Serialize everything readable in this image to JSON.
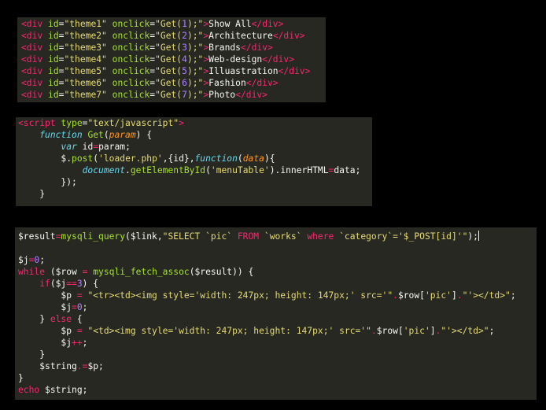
{
  "html_panel": {
    "rows": [
      {
        "id": "\"theme1\"",
        "arg": "1",
        "label": "Show All"
      },
      {
        "id": "\"theme2\"",
        "arg": "2",
        "label": "Architecture"
      },
      {
        "id": "\"theme3\"",
        "arg": "3",
        "label": "Brands"
      },
      {
        "id": "\"theme4\"",
        "arg": "4",
        "label": "Web-design"
      },
      {
        "id": "\"theme5\"",
        "arg": "5",
        "label": "Illuastration"
      },
      {
        "id": "\"theme6\"",
        "arg": "6",
        "label": "Fashion"
      },
      {
        "id": "\"theme7\"",
        "arg": "7",
        "label": "Photo"
      }
    ],
    "t_open": "<div ",
    "t_id": "id",
    "t_eq": "=",
    "t_onclick": "onclick",
    "t_quote": "\"",
    "t_get": "Get(",
    "t_closeparen": ");",
    "t_gt": ">",
    "t_close": "</div>"
  },
  "js_panel": {
    "l1_tag": "<script ",
    "l1_attr": "type",
    "l1_eq": "=",
    "l1_str": "\"text/javascript\"",
    "l1_gt": ">",
    "l2_kw": "function ",
    "l2_fn": "Get",
    "l2_p1": "(",
    "l2_param": "param",
    "l2_p2": ") {",
    "l3_kw": "var ",
    "l3_var": "id",
    "l3_op": "=",
    "l3_rest": "param;",
    "l4_a": "$.",
    "l4_fn": "post",
    "l4_b": "(",
    "l4_str": "'loader.php'",
    "l4_c": ",{id},",
    "l4_kw": "function",
    "l4_d": "(",
    "l4_param": "data",
    "l4_e": "){",
    "l5_kw": "document",
    "l5_a": ".",
    "l5_fn": "getElementById",
    "l5_b": "(",
    "l5_str": "'menuTable'",
    "l5_c": ").innerHTML",
    "l5_op": "=",
    "l5_d": "data;",
    "l6": "});",
    "l7": "}"
  },
  "php_panel": {
    "l1_a": "$result",
    "l1_op": "=",
    "l1_fn": "mysqli_query",
    "l1_b": "($link,",
    "l1_s1": "\"SELECT `pic` ",
    "l1_kw1": "FROM",
    "l1_s2": " `works` ",
    "l1_kw2": "where",
    "l1_s3": " `category`='",
    "l1_var": "$_POST[id]",
    "l1_s4": "'\"",
    "l1_end": ");",
    "l3_a": "$j",
    "l3_op": "=",
    "l3_num": "0",
    "l3_b": ";",
    "l4_kw": "while",
    "l4_a": " ($row ",
    "l4_op": "=",
    "l4_b": " ",
    "l4_fn": "mysqli_fetch_assoc",
    "l4_c": "($result)) {",
    "l5_kw": "if",
    "l5_a": "($j",
    "l5_op": "==",
    "l5_num": "3",
    "l5_b": ") {",
    "l6_a": "$p ",
    "l6_op": "=",
    "l6_s1": " \"<tr><td><img style='width: 247px; height: 147px;' src='\"",
    "l6_d1": ".",
    "l6_b": "$row[",
    "l6_s2": "'pic'",
    "l6_c": "]",
    "l6_d2": ".",
    "l6_s3": "\"'></td>\"",
    "l6_e": ";",
    "l7_a": "$j",
    "l7_op": "=",
    "l7_num": "0",
    "l7_b": ";",
    "l8_a": "} ",
    "l8_kw": "else",
    "l8_b": " {",
    "l9_a": "$p ",
    "l9_op": "=",
    "l9_s1": " \"<td><img style='width: 247px; height: 147px;' src='\"",
    "l9_d1": ".",
    "l9_b": "$row[",
    "l9_s2": "'pic'",
    "l9_c": "]",
    "l9_d2": ".",
    "l9_s3": "\"'></td>\"",
    "l9_e": ";",
    "l10_a": "$j",
    "l10_op": "++",
    "l10_b": ";",
    "l11": "}",
    "l12_a": "$string",
    "l12_op": ".=",
    "l12_b": "$p;",
    "l13": "}",
    "l14_kw": "echo",
    "l14_a": " $string;"
  }
}
